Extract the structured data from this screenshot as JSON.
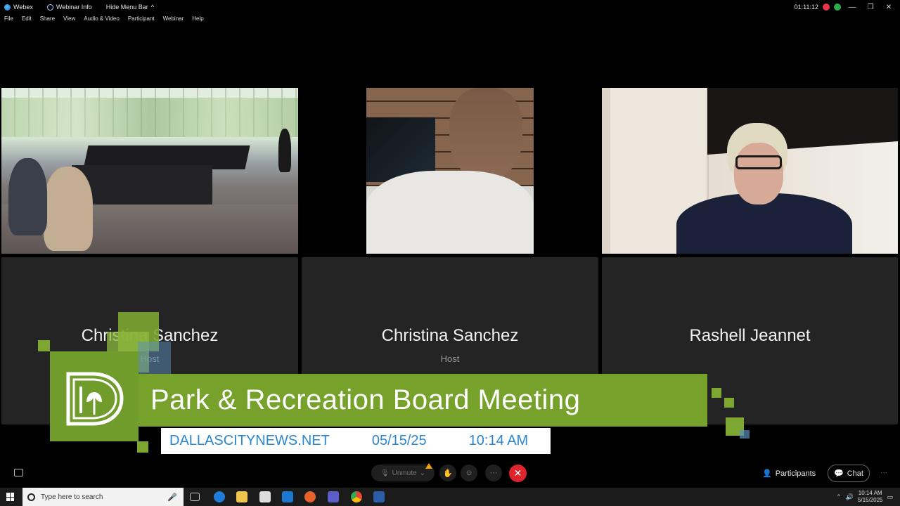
{
  "titlebar": {
    "app": "Webex",
    "webinar_info": "Webinar Info",
    "hide_menu": "Hide Menu Bar",
    "timer": "01:11:12"
  },
  "menu": [
    "File",
    "Edit",
    "Share",
    "View",
    "Audio & Video",
    "Participant",
    "Webinar",
    "Help"
  ],
  "participants": [
    {
      "name": "Christina Sanchez",
      "role": "Host"
    },
    {
      "name": "Christina Sanchez",
      "role": "Host"
    },
    {
      "name": "Rashell Jeannet",
      "role": ""
    }
  ],
  "lower_third": {
    "title": "Park & Recreation Board Meeting",
    "site": "DALLASCITYNEWS.NET",
    "date": "05/15/25",
    "time": "10:14 AM",
    "colors": {
      "green": "#76a22c",
      "blue": "#2b87d1"
    }
  },
  "controls": {
    "unmute": "Unmute",
    "participants": "Participants",
    "chat": "Chat"
  },
  "taskbar": {
    "search_placeholder": "Type here to search",
    "clock_time": "10:14 AM",
    "clock_date": "5/15/2025"
  }
}
